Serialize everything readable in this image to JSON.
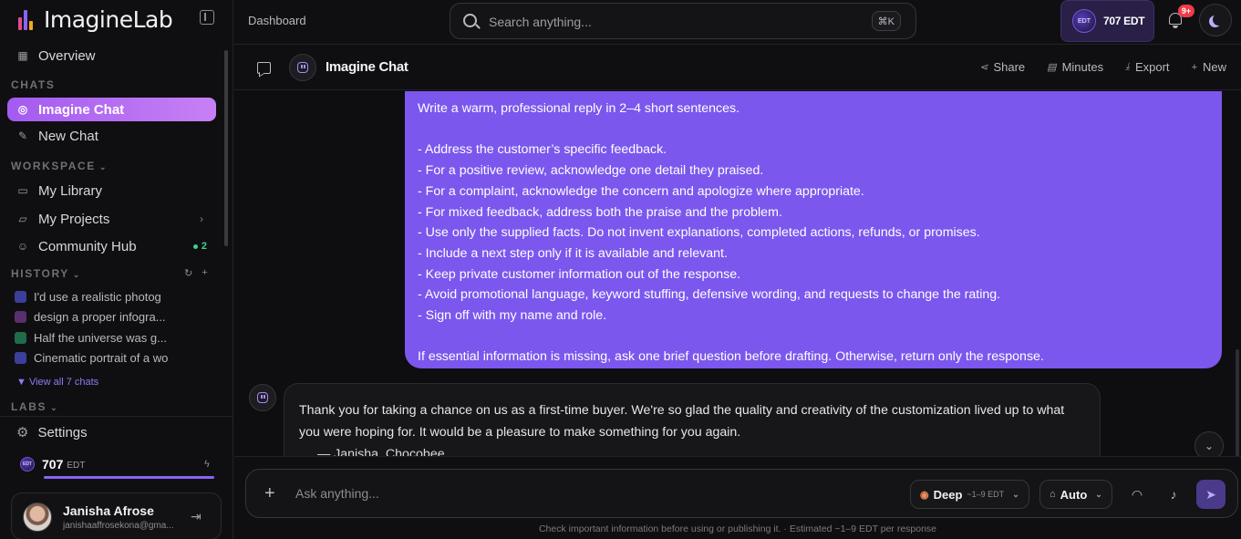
{
  "brand": {
    "name": "ImagineLab"
  },
  "sidebar": {
    "overview": "Overview",
    "chats_label": "CHATS",
    "chats": [
      {
        "label": "Imagine Chat",
        "active": true
      },
      {
        "label": "New Chat",
        "active": false
      }
    ],
    "workspace_label": "WORKSPACE",
    "workspace": [
      {
        "label": "My Library"
      },
      {
        "label": "My Projects"
      },
      {
        "label": "Community Hub",
        "badge": "2"
      }
    ],
    "history_label": "HISTORY",
    "history": [
      {
        "label": "I'd use a realistic photog",
        "color": "#3b3f9a"
      },
      {
        "label": "design a proper infogra...",
        "color": "#5b2f6e"
      },
      {
        "label": "Half the universe was g...",
        "color": "#1f6b4a"
      },
      {
        "label": "Cinematic portrait of a wo",
        "color": "#3b3f9a"
      }
    ],
    "view_all": "▼ View all 7 chats",
    "labs_label": "LABS",
    "settings": "Settings",
    "credits": {
      "value": "707",
      "unit": "EDT",
      "coin": "EDT",
      "fill_fraction": 1.0
    },
    "user": {
      "name": "Janisha Afrose",
      "email": "janishaaffrosekona@gma..."
    }
  },
  "topbar": {
    "breadcrumb": "Dashboard",
    "search_placeholder": "Search anything...",
    "shortcut": "⌘K",
    "edt_balance": "707 EDT",
    "notifications_badge": "9+"
  },
  "chat": {
    "title": "Imagine Chat",
    "actions": {
      "share": "Share",
      "minutes": "Minutes",
      "export": "Export",
      "new": "New"
    }
  },
  "messages": {
    "user_lines": [
      "Write a warm, professional reply in 2–4 short sentences.",
      "",
      "- Address the customer’s specific feedback.",
      "- For a positive review, acknowledge one detail they praised.",
      "- For a complaint, acknowledge the concern and apologize where appropriate.",
      "- For mixed feedback, address both the praise and the problem.",
      "- Use only the supplied facts. Do not invent explanations, completed actions, refunds, or promises.",
      "- Include a next step only if it is available and relevant.",
      "- Keep private customer information out of the response.",
      "- Avoid promotional language, keyword stuffing, defensive wording, and requests to change the rating.",
      "- Sign off with my name and role.",
      "",
      "If essential information is missing, ask one brief question before drafting. Otherwise, return only the response."
    ],
    "assistant_text": "Thank you for taking a chance on us as a first-time buyer. We're so glad the quality and creativity of the customization lived up to what you were hoping for. It would be a pleasure to make something for you again.",
    "assistant_signature": "— Janisha, Chocobee"
  },
  "composer": {
    "placeholder": "Ask anything...",
    "mode": {
      "label": "Deep",
      "cost": "~1–9 EDT"
    },
    "model": {
      "label": "Auto"
    },
    "disclaimer": "Check important information before using or publishing it. · Estimated ~1–9 EDT per response"
  },
  "colors": {
    "accent": "#7b57ee",
    "active_nav": "#a35bf0",
    "badge_red": "#ef3b4a",
    "online_green": "#3fcf8e"
  }
}
